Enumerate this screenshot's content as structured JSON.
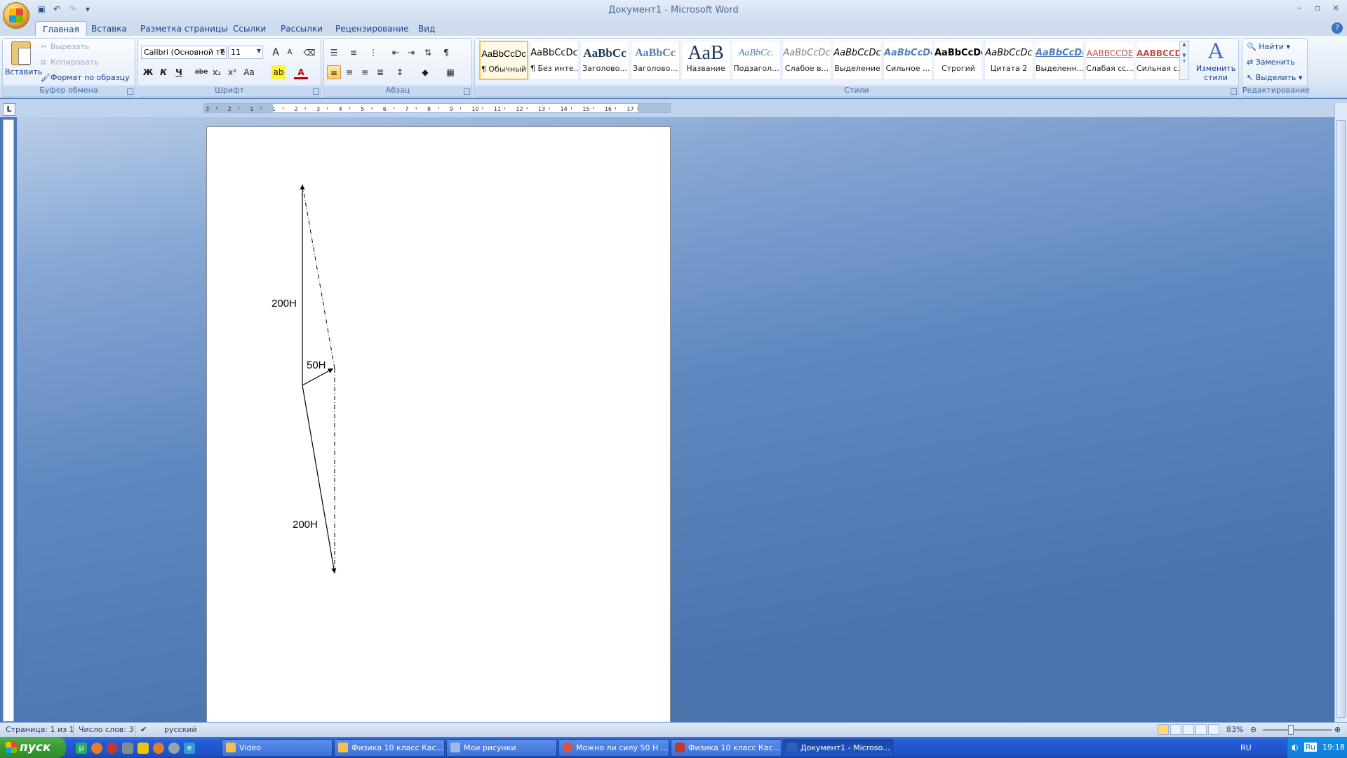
{
  "window": {
    "title": "Документ1 - Microsoft Word",
    "controls": [
      "–",
      "▫",
      "×"
    ]
  },
  "tabs": [
    "Главная",
    "Вставка",
    "Разметка страницы",
    "Ссылки",
    "Рассылки",
    "Рецензирование",
    "Вид"
  ],
  "clipboard": {
    "paste": "Вставить",
    "cut": "Вырезать",
    "copy": "Копировать",
    "format_painter": "Формат по образцу",
    "group": "Буфер обмена"
  },
  "font": {
    "name": "Calibri (Основной те",
    "size": "11",
    "group": "Шрифт",
    "bold": "Ж",
    "italic": "К",
    "underline": "Ч",
    "strike": "abe",
    "subscript": "x₂",
    "superscript": "x²",
    "case": "Aa",
    "grow": "A",
    "shrink": "A",
    "font_color_letter": "A"
  },
  "paragraph": {
    "group": "Абзац",
    "pilcrow": "¶"
  },
  "styles": {
    "group": "Стили",
    "items": [
      {
        "sample": "AaBbCcDc",
        "name": "¶ Обычный"
      },
      {
        "sample": "AaBbCcDc",
        "name": "¶ Без инте..."
      },
      {
        "sample": "AaBbCc",
        "name": "Заголово..."
      },
      {
        "sample": "AaBbCc",
        "name": "Заголово..."
      },
      {
        "sample": "AaB",
        "name": "Название"
      },
      {
        "sample": "AaBbCc.",
        "name": "Подзагол..."
      },
      {
        "sample": "AaBbCcDc",
        "name": "Слабое в..."
      },
      {
        "sample": "AaBbCcDc",
        "name": "Выделение"
      },
      {
        "sample": "AaBbCcDc",
        "name": "Сильное ..."
      },
      {
        "sample": "AaBbCcDc",
        "name": "Строгий"
      },
      {
        "sample": "AaBbCcDc",
        "name": "Цитата 2"
      },
      {
        "sample": "AaBbCcDc",
        "name": "Выделенн..."
      },
      {
        "sample": "AABBCCDE",
        "name": "Слабая сс..."
      },
      {
        "sample": "AABBCCDE",
        "name": "Сильная с..."
      }
    ],
    "change_styles_line1": "Изменить",
    "change_styles_line2": "стили"
  },
  "editing": {
    "group": "Редактирование",
    "find": "Найти",
    "replace": "Заменить",
    "select": "Выделить"
  },
  "document": {
    "labels": {
      "force_top": "200Н",
      "force_small": "50Н",
      "force_bottom": "200Н"
    }
  },
  "ruler": {
    "numbers": [
      "3",
      "2",
      "1",
      "1",
      "2",
      "3",
      "4",
      "5",
      "6",
      "7",
      "8",
      "9",
      "10",
      "11",
      "12",
      "13",
      "14",
      "15",
      "16",
      "17"
    ]
  },
  "status": {
    "page": "Страница: 1 из 1",
    "words": "Число слов: 3",
    "language": "русский",
    "zoom": "83%"
  },
  "taskbar": {
    "start": "пуск",
    "items": [
      {
        "label": "Video",
        "icon_color": "#f2c14e"
      },
      {
        "label": "Физика 10 класс Кас...",
        "icon_color": "#f2c14e"
      },
      {
        "label": "Мои рисунки",
        "icon_color": "#9ab8e8"
      },
      {
        "label": "Можно ли силу 50 Н ...",
        "icon_color": "#e0533b"
      },
      {
        "label": "Физика 10 класс Кас...",
        "icon_color": "#c0392b"
      },
      {
        "label": "Документ1 - Microso...",
        "icon_color": "#2b5fb8"
      }
    ],
    "lang": "RU",
    "clock": "19:18",
    "tray_lang": "Ru"
  }
}
